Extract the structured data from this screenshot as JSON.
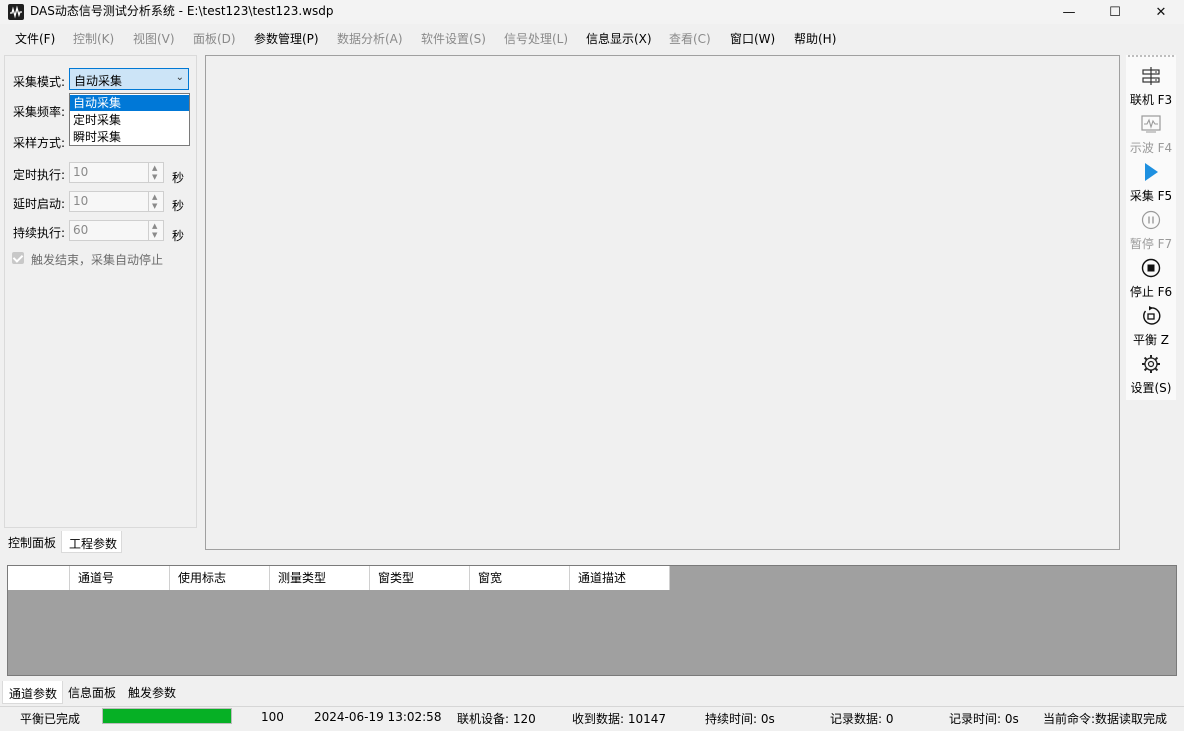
{
  "window": {
    "title": "DAS动态信号测试分析系统 - E:\\test123\\test123.wsdp",
    "minimize_glyph": "—",
    "maximize_glyph": "☐",
    "close_glyph": "✕"
  },
  "menu": [
    {
      "label": "文件(F)",
      "enabled": true
    },
    {
      "label": "控制(K)",
      "enabled": false
    },
    {
      "label": "视图(V)",
      "enabled": false
    },
    {
      "label": "面板(D)",
      "enabled": false
    },
    {
      "label": "参数管理(P)",
      "enabled": true
    },
    {
      "label": "数据分析(A)",
      "enabled": false
    },
    {
      "label": "软件设置(S)",
      "enabled": false
    },
    {
      "label": "信号处理(L)",
      "enabled": false
    },
    {
      "label": "信息显示(X)",
      "enabled": true
    },
    {
      "label": "查看(C)",
      "enabled": false
    },
    {
      "label": "窗口(W)",
      "enabled": true
    },
    {
      "label": "帮助(H)",
      "enabled": true
    }
  ],
  "control_panel": {
    "mode_label": "采集模式:",
    "mode_value": "自动采集",
    "mode_options": [
      "自动采集",
      "定时采集",
      "瞬时采集"
    ],
    "freq_label": "采集频率:",
    "sample_label": "采样方式:",
    "timed_exec_label": "定时执行:",
    "timed_exec_value": "10",
    "delay_start_label": "延时启动:",
    "delay_start_value": "10",
    "continuous_label": "持续执行:",
    "continuous_value": "60",
    "unit_seconds": "秒",
    "trigger_stop_label": "触发结束，采集自动停止",
    "trigger_stop_checked": true
  },
  "left_tabs": [
    "控制面板",
    "工程参数"
  ],
  "toolbar": [
    {
      "label": "联机 F3",
      "icon": "connect-icon",
      "enabled": true
    },
    {
      "label": "示波 F4",
      "icon": "oscilloscope-icon",
      "enabled": false
    },
    {
      "label": "采集 F5",
      "icon": "play-icon",
      "enabled": true
    },
    {
      "label": "暂停 F7",
      "icon": "pause-icon",
      "enabled": false
    },
    {
      "label": "停止 F6",
      "icon": "stop-icon",
      "enabled": true
    },
    {
      "label": "平衡 Z",
      "icon": "balance-icon",
      "enabled": true
    },
    {
      "label": "设置(S)",
      "icon": "gear-icon",
      "enabled": true
    }
  ],
  "channel_table": {
    "columns": [
      "",
      "通道号",
      "使用标志",
      "测量类型",
      "窗类型",
      "窗宽",
      "通道描述"
    ]
  },
  "bottom_tabs": [
    "通道参数",
    "信息面板",
    "触发参数"
  ],
  "status": {
    "balance": "平衡已完成",
    "progress": 100,
    "progress_text": "100",
    "datetime": "2024-06-19 13:02:58",
    "online_devices": "联机设备: 120",
    "received": "收到数据: 10147",
    "duration": "持续时间: 0s",
    "records": "记录数据: 0",
    "record_time": "记录时间: 0s",
    "command": "当前命令:数据读取完成",
    "progress_color": "#06b025"
  },
  "colors": {
    "accent": "#0078d4",
    "play": "#1e90e0",
    "grid_bg": "#a0a0a0"
  }
}
